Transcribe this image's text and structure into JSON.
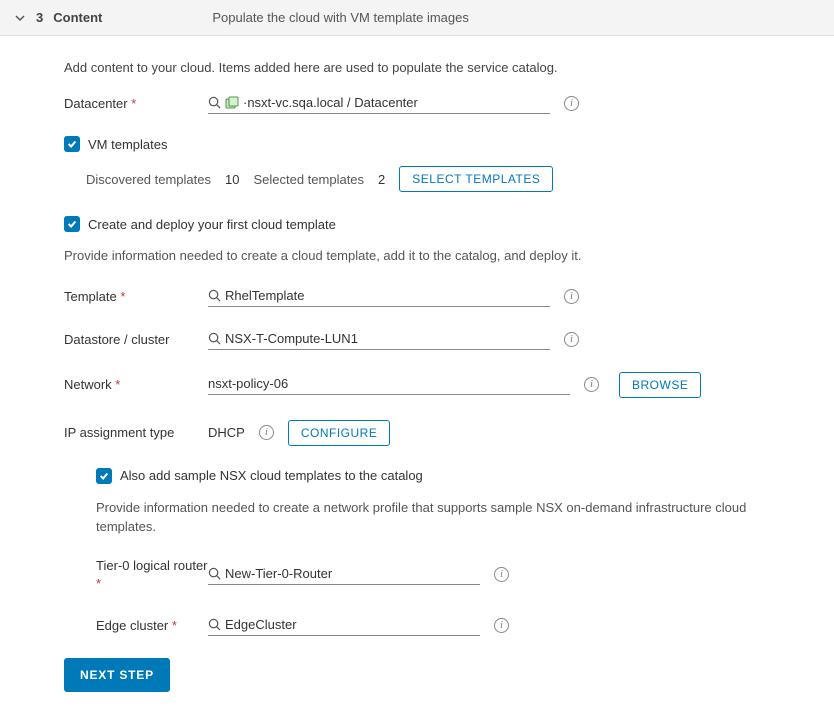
{
  "header": {
    "step_number": "3",
    "step_title": "Content",
    "step_desc": "Populate the cloud with VM template images"
  },
  "intro": "Add content to your cloud. Items added here are used to populate the service catalog.",
  "datacenter": {
    "label": "Datacenter",
    "value": "·nsxt-vc.sqa.local / Datacenter"
  },
  "vm_templates": {
    "label": "VM templates",
    "discovered_label": "Discovered templates",
    "discovered_count": "10",
    "selected_label": "Selected templates",
    "selected_count": "2",
    "select_btn": "SELECT TEMPLATES"
  },
  "create_deploy": {
    "label": "Create and deploy your first cloud template",
    "desc": "Provide information needed to create a cloud template, add it to the catalog, and deploy it."
  },
  "template": {
    "label": "Template",
    "value": "RhelTemplate"
  },
  "datastore": {
    "label": "Datastore / cluster",
    "value": "NSX-T-Compute-LUN1"
  },
  "network": {
    "label": "Network",
    "value": "nsxt-policy-06",
    "browse": "BROWSE"
  },
  "ip": {
    "label": "IP assignment type",
    "value": "DHCP",
    "configure": "CONFIGURE"
  },
  "nsx": {
    "label": "Also add sample NSX cloud templates to the catalog",
    "desc": "Provide information needed to create a network profile that supports sample NSX on-demand infrastructure cloud templates.",
    "tier0_label": "Tier-0 logical router",
    "tier0_value": "New-Tier-0-Router",
    "edge_label": "Edge cluster",
    "edge_value": "EdgeCluster"
  },
  "next_btn": "NEXT STEP"
}
